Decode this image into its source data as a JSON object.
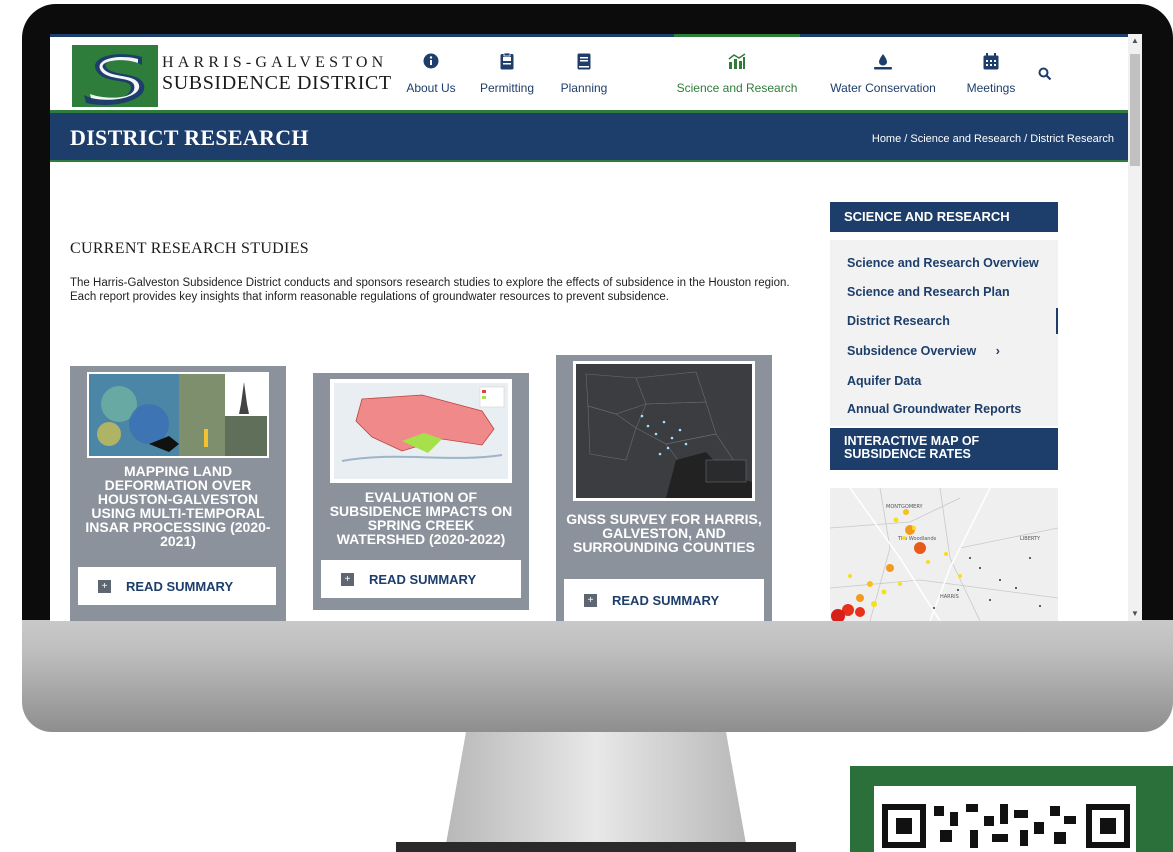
{
  "header": {
    "logo": {
      "line1": "HARRIS-GALVESTON",
      "line2": "SUBSIDENCE DISTRICT"
    },
    "nav": [
      {
        "label": "About Us",
        "icon": "info-icon"
      },
      {
        "label": "Permitting",
        "icon": "clipboard-icon"
      },
      {
        "label": "Planning",
        "icon": "book-icon"
      },
      {
        "label": "Science and Research",
        "icon": "chart-icon",
        "active": true
      },
      {
        "label": "Water Conservation",
        "icon": "water-drop-icon"
      },
      {
        "label": "Meetings",
        "icon": "calendar-icon"
      }
    ],
    "search_icon": "search-icon"
  },
  "title_bar": {
    "title": "DISTRICT RESEARCH",
    "breadcrumb": [
      "Home",
      "Science and Research",
      "District Research"
    ],
    "separator": " / "
  },
  "main": {
    "section_heading": "CURRENT RESEARCH STUDIES",
    "intro": "The Harris-Galveston Subsidence District conducts and sponsors research studies to explore the effects of subsidence in the Houston region. Each report provides key insights that inform reasonable regulations of groundwater resources to prevent subsidence.",
    "cards": [
      {
        "title": "MAPPING LAND DEFORMATION OVER HOUSTON-GALVESTON USING MULTI-TEMPORAL INSAR PROCESSING (2020-2021)",
        "button": "READ SUMMARY"
      },
      {
        "title": "EVALUATION OF SUBSIDENCE IMPACTS ON SPRING CREEK WATERSHED (2020-2022)",
        "button": "READ SUMMARY"
      },
      {
        "title": "GNSS SURVEY FOR HARRIS, GALVESTON, AND SURROUNDING COUNTIES",
        "button": "READ SUMMARY"
      }
    ]
  },
  "sidebar": {
    "heading": "SCIENCE AND RESEARCH",
    "items": [
      {
        "label": "Science and Research Overview"
      },
      {
        "label": "Science and Research Plan"
      },
      {
        "label": "District Research",
        "active": true
      },
      {
        "label": "Subsidence Overview",
        "chevron": "›"
      },
      {
        "label": "Aquifer Data"
      },
      {
        "label": "Annual Groundwater Reports"
      }
    ],
    "map_heading": "INTERACTIVE MAP OF SUBSIDENCE RATES",
    "map_labels": [
      "MONTGOMERY",
      "The Woodlands",
      "LIBERTY",
      "HARRIS"
    ]
  },
  "colors": {
    "navy": "#1d3e6b",
    "green": "#2e7d3a",
    "card_gray": "#8c929b"
  }
}
